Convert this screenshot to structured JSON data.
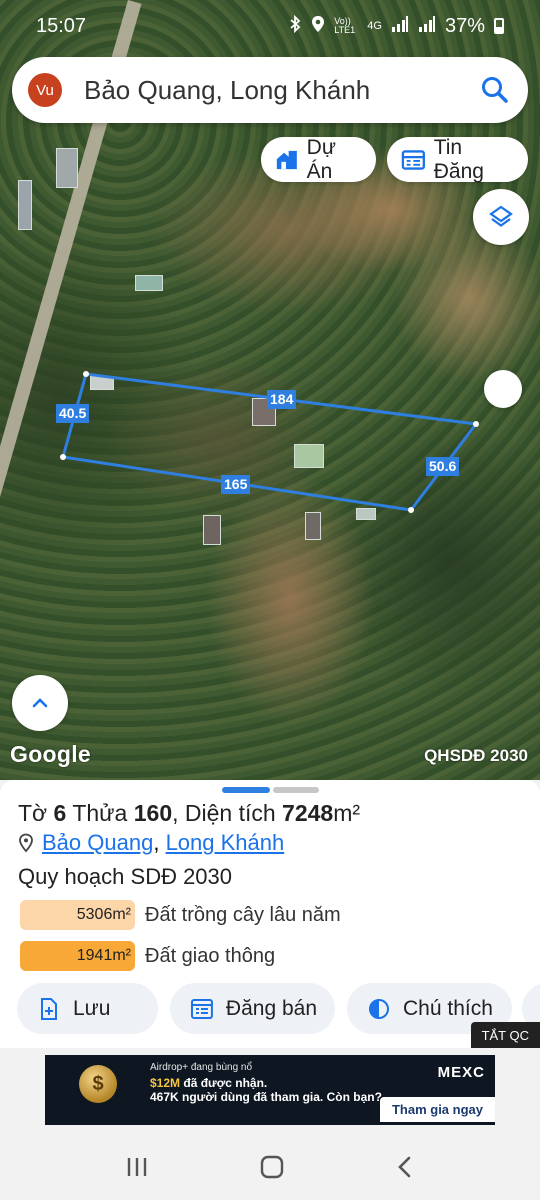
{
  "status_bar": {
    "time": "15:07",
    "network": "Vo)) LTE1",
    "network_type": "4G",
    "battery": "37%"
  },
  "search": {
    "avatar_text": "Vu",
    "query": "Bảo Quang, Long Khánh"
  },
  "chips": {
    "du_an": "Dự Án",
    "tin_dang": "Tin Đăng"
  },
  "map": {
    "edge_lengths": {
      "top": "184",
      "left": "40.5",
      "bottom": "165",
      "right": "50.6"
    },
    "attribution": "Google",
    "layer_label": "QHSDĐ 2030"
  },
  "parcel": {
    "title_prefix": "Tờ",
    "sheet_no": "6",
    "plot_word": "Thửa",
    "plot_no": "160",
    "area_word": ", Diện tích",
    "area": "7248",
    "area_unit": "m²",
    "location_ward": "Bảo Quang",
    "location_separator": ",",
    "location_city": "Long Khánh",
    "planning_title": "Quy hoạch SDĐ 2030",
    "land_uses": [
      {
        "area": "5306m²",
        "label": "Đất trồng cây lâu năm",
        "color": "#fcd5a8"
      },
      {
        "area": "1941m²",
        "label": "Đất giao thông",
        "color": "#f7a836"
      }
    ]
  },
  "actions": {
    "save": "Lưu",
    "post_sale": "Đăng bán",
    "legend": "Chú thích"
  },
  "ad": {
    "close_label": "TẮT QC",
    "line1": "Airdrop+ đang bùng nổ",
    "line2_amount": "$12M",
    "line2_rest": " đã được nhận.",
    "line3": "467K người dùng đã tham gia. Còn bạn?",
    "brand": "MEXC",
    "cta": "Tham gia ngay"
  },
  "colors": {
    "accent": "#1a73e8",
    "parcel_outline": "#2f7fe0",
    "avatar": "#c8411e"
  }
}
